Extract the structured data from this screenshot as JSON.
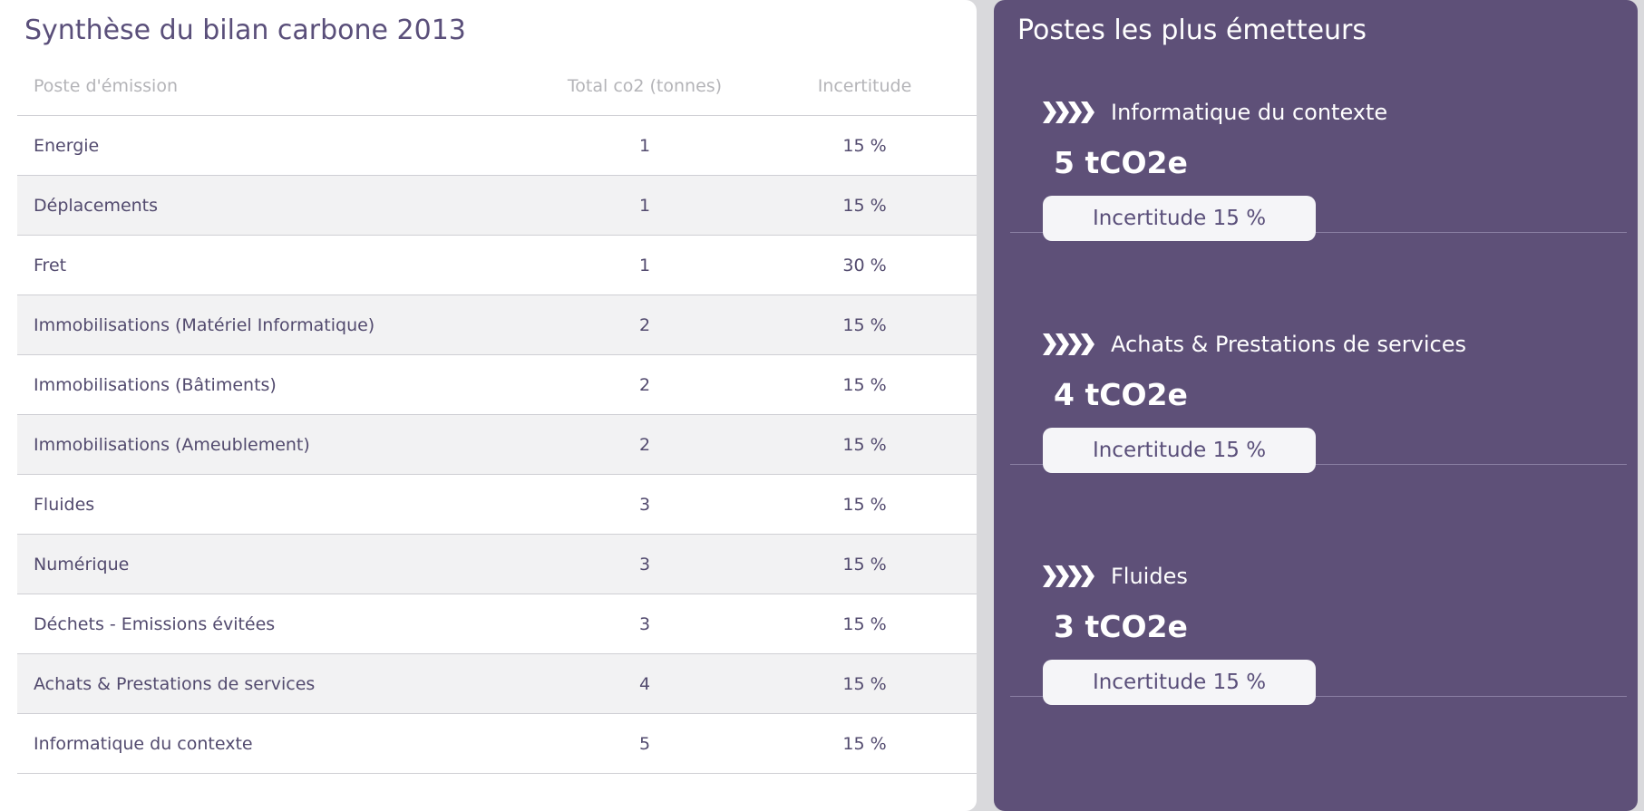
{
  "left_panel": {
    "title": "Synthèse du bilan carbone 2013",
    "columns": [
      "Poste d'émission",
      "Total co2 (tonnes)",
      "Incertitude"
    ],
    "rows": [
      {
        "name": "Energie",
        "total": "1",
        "uncertainty": "15 %"
      },
      {
        "name": "Déplacements",
        "total": "1",
        "uncertainty": "15 %"
      },
      {
        "name": "Fret",
        "total": "1",
        "uncertainty": "30 %"
      },
      {
        "name": "Immobilisations (Matériel Informatique)",
        "total": "2",
        "uncertainty": "15 %"
      },
      {
        "name": "Immobilisations (Bâtiments)",
        "total": "2",
        "uncertainty": "15 %"
      },
      {
        "name": "Immobilisations (Ameublement)",
        "total": "2",
        "uncertainty": "15 %"
      },
      {
        "name": "Fluides",
        "total": "3",
        "uncertainty": "15 %"
      },
      {
        "name": "Numérique",
        "total": "3",
        "uncertainty": "15 %"
      },
      {
        "name": "Déchets - Emissions évitées",
        "total": "3",
        "uncertainty": "15 %"
      },
      {
        "name": "Achats & Prestations de services",
        "total": "4",
        "uncertainty": "15 %"
      },
      {
        "name": "Informatique du contexte",
        "total": "5",
        "uncertainty": "15 %"
      }
    ]
  },
  "right_panel": {
    "title": "Postes les plus émetteurs",
    "items": [
      {
        "icon": "chevrons-right-icon",
        "name": "Informatique du contexte",
        "value": "5 tCO2e",
        "badge": "Incertitude 15 %"
      },
      {
        "icon": "chevrons-right-icon",
        "name": "Achats & Prestations de services",
        "value": "4 tCO2e",
        "badge": "Incertitude 15 %"
      },
      {
        "icon": "chevrons-right-icon",
        "name": "Fluides",
        "value": "3 tCO2e",
        "badge": "Incertitude 15 %"
      }
    ]
  },
  "colors": {
    "accent_purple": "#5e5078",
    "text_purple": "#5a4f7a",
    "header_gray": "#b4b4b8",
    "row_alt": "#f2f2f3"
  }
}
